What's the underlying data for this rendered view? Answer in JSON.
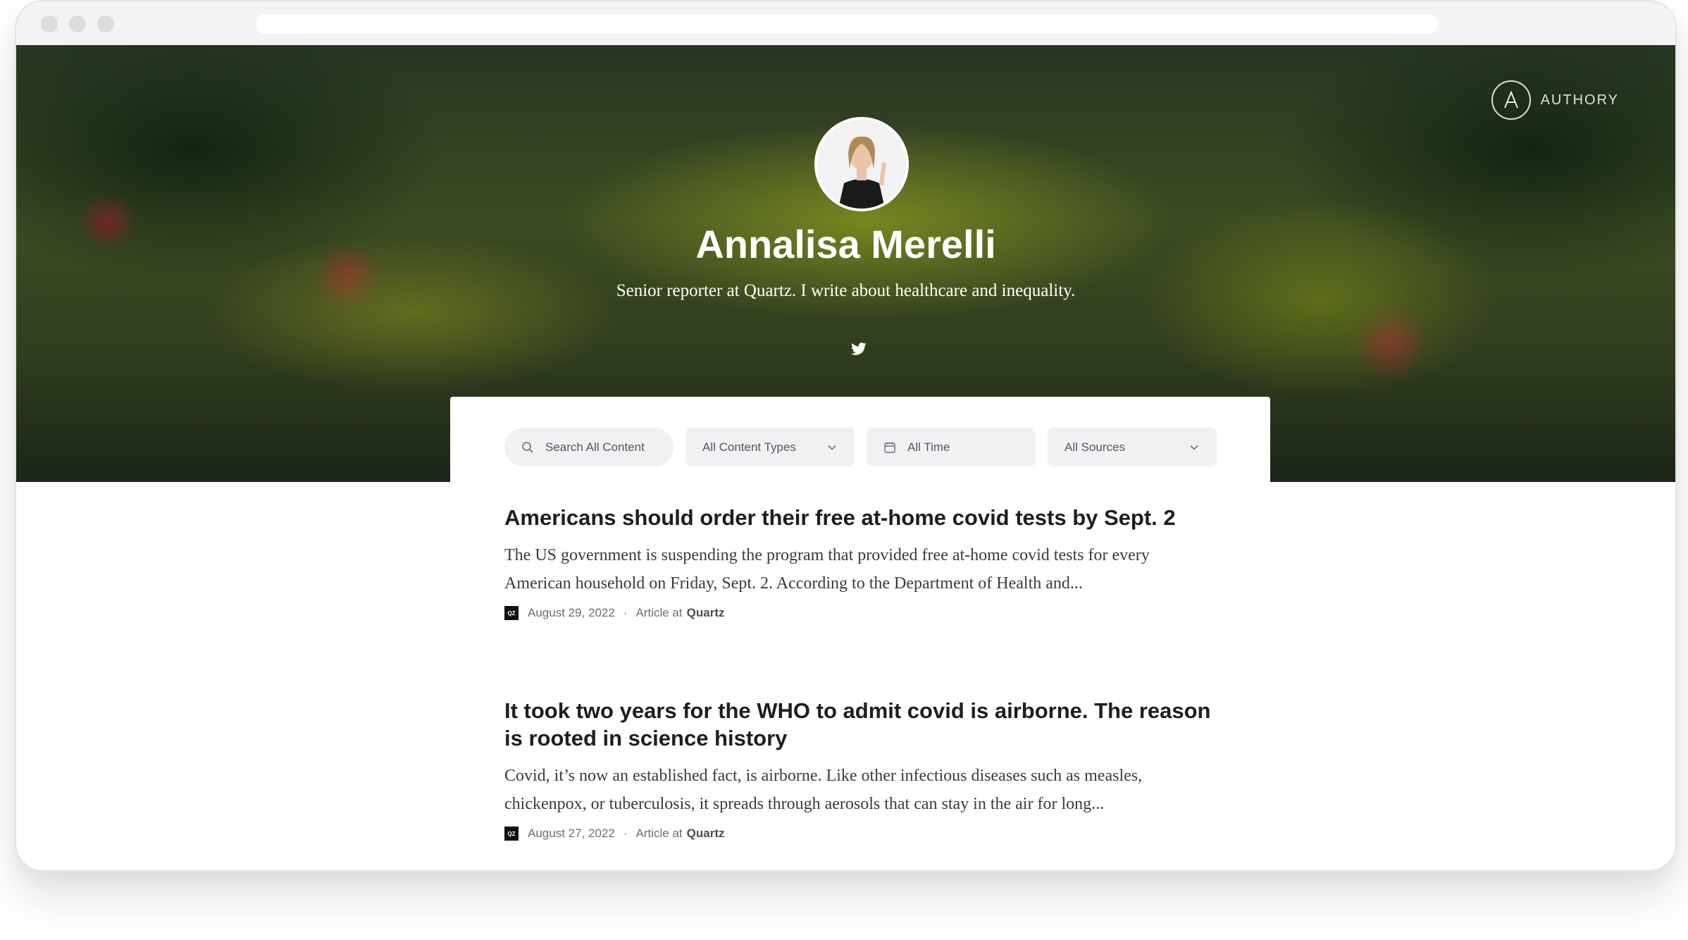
{
  "brand": {
    "name": "AUTHORY"
  },
  "profile": {
    "name": "Annalisa Merelli",
    "bio": "Senior reporter at Quartz. I write about healthcare and inequality."
  },
  "filters": {
    "search_placeholder": "Search All Content",
    "content_types": "All Content Types",
    "time": "All Time",
    "sources": "All Sources"
  },
  "articles": [
    {
      "title": "Americans should order their free at-home covid tests by Sept. 2",
      "excerpt": "The US government is suspending the program that provided free at-home covid tests for every American household on Friday, Sept. 2. According to the Department of Health and...",
      "date": "August 29, 2022",
      "type_prefix": "Article at",
      "source": "Quartz",
      "source_icon": "QZ"
    },
    {
      "title": "It took two years for the WHO to admit covid is airborne. The reason is rooted in science history",
      "excerpt": "Covid, it’s now an established fact, is airborne. Like other infectious diseases such as measles, chickenpox, or tuberculosis, it spreads through aerosols that can stay in the air for long...",
      "date": "August 27, 2022",
      "type_prefix": "Article at",
      "source": "Quartz",
      "source_icon": "QZ"
    }
  ],
  "meta_separator": "·",
  "icons": {
    "twitter": "twitter-icon",
    "search": "search-icon",
    "calendar": "calendar-icon",
    "chevron": "chevron-down-icon",
    "logo": "authory-logo-icon"
  }
}
